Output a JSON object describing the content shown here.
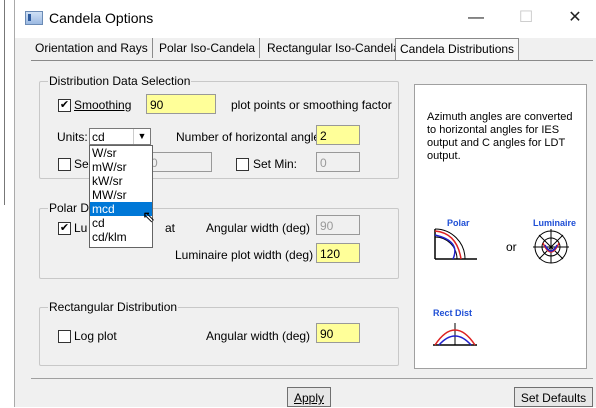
{
  "window": {
    "title": "Candela Options",
    "minimize": "—",
    "maximize": "☐",
    "close": "✕"
  },
  "tabs": [
    {
      "label": "Orientation and Rays"
    },
    {
      "label": "Polar Iso-Candela"
    },
    {
      "label": "Rectangular Iso-Candela"
    },
    {
      "label": "Candela Distributions"
    }
  ],
  "distribution": {
    "group_label": "Distribution Data Selection",
    "smoothing_label": "Smoothing",
    "smoothing_checked": "✔",
    "smoothing_value": "90",
    "smoothing_suffix": "plot points or smoothing factor",
    "units_label": "Units:",
    "units_value": "cd",
    "unit_options": [
      "W/sr",
      "mW/sr",
      "kW/sr",
      "MW/sr",
      "mcd",
      "cd",
      "cd/klm"
    ],
    "unit_selected_index": 4,
    "horiz_label": "Number of horizontal angles:",
    "horiz_value": "2",
    "set_max_label": "Se",
    "set_max_value": "0",
    "set_min_label": "Set Min:",
    "set_min_value": "0"
  },
  "polar": {
    "group_label": "Polar Di",
    "luminaire_label_start": "Lu",
    "luminaire_label_end": "at",
    "luminaire_checked": "✔",
    "angular_label": "Angular width (deg)",
    "angular_value": "90",
    "plot_width_label": "Luminaire plot width (deg)",
    "plot_width_value": "120"
  },
  "rect": {
    "group_label": "Rectangular Distribution",
    "log_label": "Log plot",
    "angular_label": "Angular width (deg)",
    "angular_value": "90"
  },
  "panel": {
    "note": "Azimuth angles are converted to horizontal angles for IES output and C angles for LDT output.",
    "polar_icon_label": "Polar",
    "or_label": "or",
    "luminaire_icon_label": "Luminaire",
    "rect_icon_label": "Rect Dist"
  },
  "buttons": {
    "apply": "Apply",
    "set_defaults": "Set Defaults"
  },
  "colors": {
    "highlight": "#0078d7",
    "field": "#ffff99",
    "icon_label": "#1f4fd6"
  }
}
